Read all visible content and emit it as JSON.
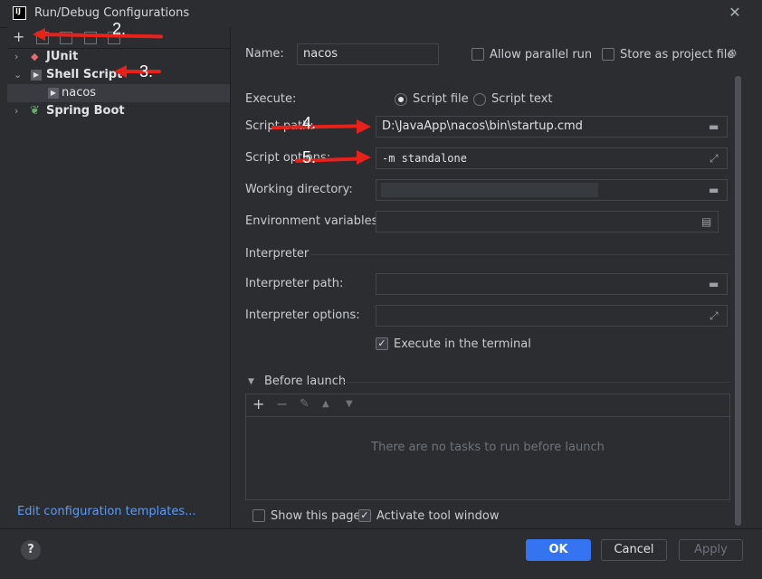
{
  "window": {
    "title": "Run/Debug Configurations"
  },
  "left_panel": {
    "tree": [
      {
        "label": "JUnit",
        "expanded": false
      },
      {
        "label": "Shell Script",
        "expanded": true
      },
      {
        "label": "nacos",
        "child": true,
        "selected": true
      },
      {
        "label": "Spring Boot",
        "expanded": false
      }
    ],
    "edit_templates_link": "Edit configuration templates..."
  },
  "form": {
    "name_label": "Name:",
    "name_value": "nacos",
    "allow_parallel": "Allow parallel run",
    "store_project": "Store as project file",
    "execute_label": "Execute:",
    "radio_script_file": "Script file",
    "radio_script_text": "Script text",
    "script_path_label": "Script path:",
    "script_path_value": "D:\\JavaApp\\nacos\\bin\\startup.cmd",
    "script_options_label": "Script options:",
    "script_options_value": "-m standalone",
    "working_dir_label": "Working directory:",
    "env_vars_label": "Environment variables:",
    "interpreter_section": "Interpreter",
    "interpreter_path_label": "Interpreter path:",
    "interpreter_options_label": "Interpreter options:",
    "execute_in_terminal": "Execute in the terminal",
    "before_launch": "Before launch",
    "before_launch_empty": "There are no tasks to run before launch",
    "show_this_page": "Show this page",
    "activate_tool_window": "Activate tool window"
  },
  "buttons": {
    "ok": "OK",
    "cancel": "Cancel",
    "apply": "Apply",
    "help": "?"
  },
  "annotations": {
    "a2": "2.",
    "a3": "3.",
    "a4": "4.",
    "a5": "5."
  },
  "colors": {
    "accent": "#3574f0",
    "annotation_arrow": "#e8211b",
    "link": "#5e9bf5"
  }
}
